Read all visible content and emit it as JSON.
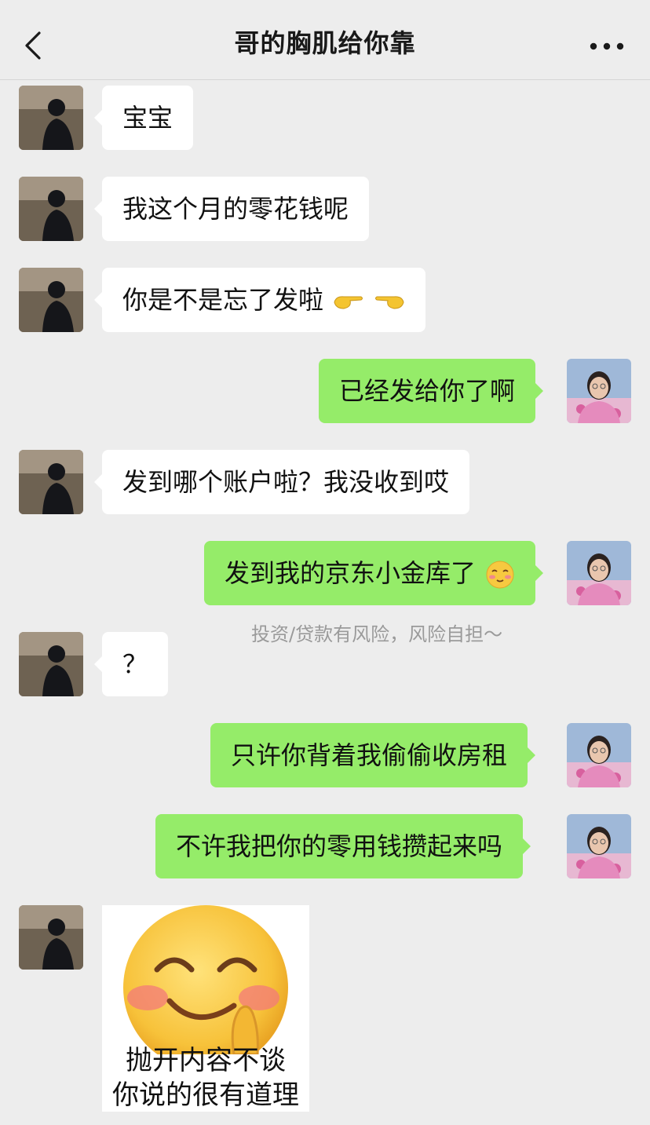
{
  "header": {
    "title": "哥的胸肌给你靠",
    "back_icon": "chevron-left-icon",
    "more_icon": "more-dots-icon"
  },
  "messages": [
    {
      "side": "left",
      "text": "宝宝"
    },
    {
      "side": "left",
      "text": "我这个月的零花钱呢"
    },
    {
      "side": "left",
      "text": "你是不是忘了发啦",
      "emoji": [
        "pointing-right-icon",
        "pointing-left-icon"
      ]
    },
    {
      "side": "right",
      "text": "已经发给你了啊"
    },
    {
      "side": "left",
      "text": "发到哪个账户啦？我没收到哎"
    },
    {
      "side": "right",
      "text": "发到我的京东小金库了",
      "emoji": [
        "blushing-smile-icon"
      ]
    },
    {
      "side": "left",
      "text": "？"
    },
    {
      "side": "right",
      "text": "只许你背着我偷偷收房租"
    },
    {
      "side": "right",
      "text": "不许我把你的零用钱攒起来吗"
    }
  ],
  "notice": "投资/贷款有风险，风险自担～",
  "sticker": {
    "line1": "抛开内容不谈",
    "line2": "你说的很有道理"
  },
  "colors": {
    "background": "#ededed",
    "left_bubble": "#ffffff",
    "right_bubble": "#95ec69"
  }
}
